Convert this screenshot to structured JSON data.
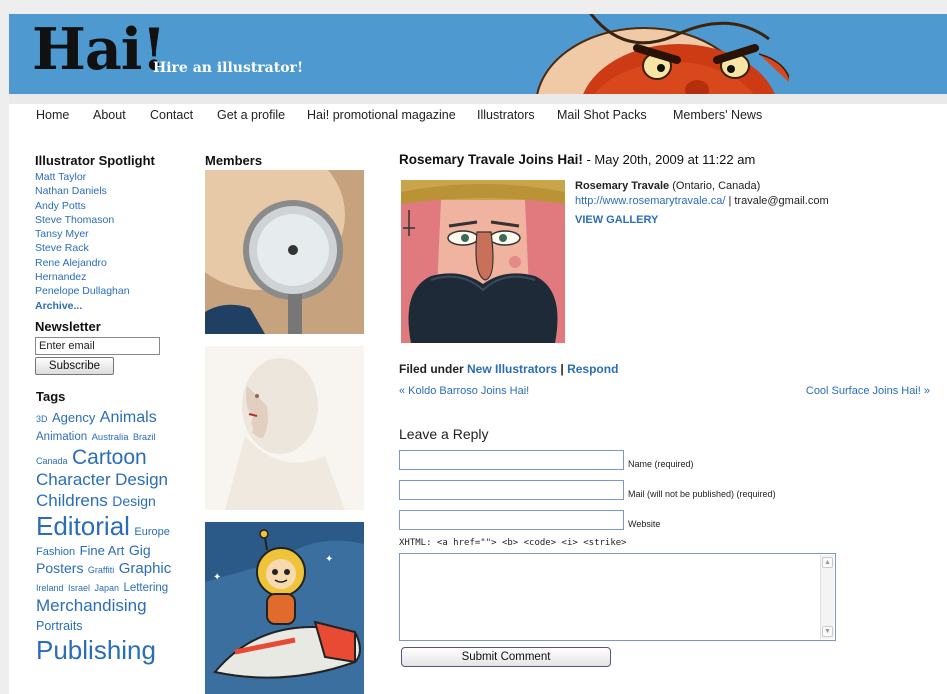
{
  "header": {
    "logo": "Hai!",
    "tagline": "Hire an illustrator!",
    "brand_color": "#4e9ad0"
  },
  "nav": [
    {
      "label": "Home"
    },
    {
      "label": "About"
    },
    {
      "label": "Contact"
    },
    {
      "label": "Get a profile"
    },
    {
      "label": "Hai! promotional magazine"
    },
    {
      "label": "Illustrators"
    },
    {
      "label": "Mail Shot Packs"
    },
    {
      "label": "Members' News"
    }
  ],
  "sidebar": {
    "spotlight_title": "Illustrator Spotlight",
    "spotlight": [
      "Matt Taylor",
      "Nathan Daniels",
      "Andy Potts",
      "Steve Thomason",
      "Tansy Myer",
      "Steve Rack",
      "Rene Alejandro",
      "Hernandez",
      "Penelope Dullaghan"
    ],
    "archive_label": "Archive...",
    "newsletter_title": "Newsletter",
    "email_value": "Enter email",
    "subscribe_label": "Subscribe",
    "tags_title": "Tags",
    "tags": [
      {
        "label": "3D",
        "size": 9
      },
      {
        "label": "Agency",
        "size": 13
      },
      {
        "label": "Animals",
        "size": 16
      },
      {
        "label": "Animation",
        "size": 11.5
      },
      {
        "label": "Australia",
        "size": 9.5
      },
      {
        "label": "Brazil",
        "size": 9
      },
      {
        "label": "Canada",
        "size": 9
      },
      {
        "label": "Cartoon",
        "size": 21
      },
      {
        "label": "Character",
        "size": 17
      },
      {
        "label": "Design",
        "size": 17
      },
      {
        "label": "Childrens",
        "size": 17
      },
      {
        "label": "Design",
        "size": 14
      },
      {
        "label": "Editorial",
        "size": 26
      },
      {
        "label": "Europe",
        "size": 11
      },
      {
        "label": "Fashion",
        "size": 11
      },
      {
        "label": "Fine Art",
        "size": 13
      },
      {
        "label": "Gig Posters",
        "size": 14
      },
      {
        "label": "Graffiti",
        "size": 9
      },
      {
        "label": "Graphic",
        "size": 15
      },
      {
        "label": "Ireland",
        "size": 9
      },
      {
        "label": "Israel",
        "size": 9
      },
      {
        "label": "Japan",
        "size": 9
      },
      {
        "label": "Lettering",
        "size": 11.5
      },
      {
        "label": "Merchandising",
        "size": 17
      },
      {
        "label": "Portraits",
        "size": 12.5
      },
      {
        "label": "Publishing",
        "size": 26
      }
    ]
  },
  "members": {
    "title": "Members"
  },
  "article": {
    "title": "Rosemary Travale Joins Hai!",
    "date": " - May 20th, 2009 at 11:22 am",
    "artist_name": "Rosemary Travale",
    "artist_location": " (Ontario, Canada)",
    "artist_url": "http://www.rosemarytravale.ca/",
    "artist_email": " | travale@gmail.com",
    "view_gallery": "VIEW GALLERY",
    "filed_prefix": "Filed under ",
    "filed_category": "New Illustrators",
    "filed_sep": " | ",
    "respond": "Respond",
    "prev_post": "« Koldo Barroso Joins Hai!",
    "next_post": "Cool Surface Joins Hai! »"
  },
  "reply": {
    "title": "Leave a Reply",
    "name_label": "Name (required)",
    "mail_label": "Mail (will not be published) (required)",
    "website_label": "Website",
    "xhtml": "XHTML: <a href=\"\"> <b> <code> <i> <strike>",
    "submit_label": "Submit Comment"
  },
  "link_color": "#2a6db8"
}
